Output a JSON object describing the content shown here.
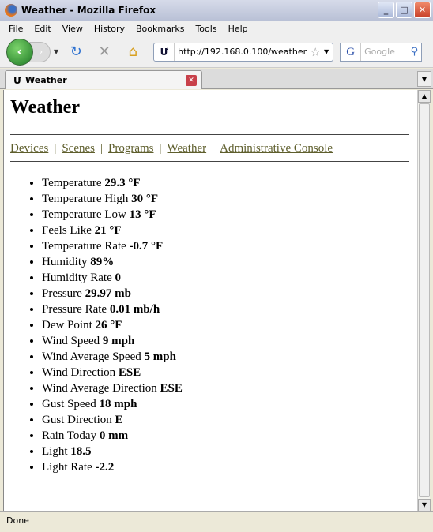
{
  "window": {
    "title": "Weather - Mozilla Firefox"
  },
  "menu": [
    "File",
    "Edit",
    "View",
    "History",
    "Bookmarks",
    "Tools",
    "Help"
  ],
  "toolbar": {
    "url": "http://192.168.0.100/weather",
    "search_placeholder": "Google",
    "search_engine": "G"
  },
  "tab": {
    "label": "Weather"
  },
  "page": {
    "title": "Weather",
    "nav": [
      "Devices",
      "Scenes",
      "Programs",
      "Weather",
      "Administrative Console"
    ],
    "items": [
      {
        "label": "Temperature",
        "value": "29.3 °F"
      },
      {
        "label": "Temperature High",
        "value": "30 °F"
      },
      {
        "label": "Temperature Low",
        "value": "13 °F"
      },
      {
        "label": "Feels Like",
        "value": "21 °F"
      },
      {
        "label": "Temperature Rate",
        "value": "-0.7 °F"
      },
      {
        "label": "Humidity",
        "value": "89%"
      },
      {
        "label": "Humidity Rate",
        "value": "0"
      },
      {
        "label": "Pressure",
        "value": "29.97 mb"
      },
      {
        "label": "Pressure Rate",
        "value": "0.01 mb/h"
      },
      {
        "label": "Dew Point",
        "value": "26 °F"
      },
      {
        "label": "Wind Speed",
        "value": "9 mph"
      },
      {
        "label": "Wind Average Speed",
        "value": "5 mph"
      },
      {
        "label": "Wind Direction",
        "value": "ESE"
      },
      {
        "label": "Wind Average Direction",
        "value": "ESE"
      },
      {
        "label": "Gust Speed",
        "value": "18 mph"
      },
      {
        "label": "Gust Direction",
        "value": "E"
      },
      {
        "label": "Rain Today",
        "value": "0 mm"
      },
      {
        "label": "Light",
        "value": "18.5"
      },
      {
        "label": "Light Rate",
        "value": "-2.2"
      }
    ]
  },
  "status": "Done",
  "colors": {
    "link": "#5e5e2c"
  }
}
